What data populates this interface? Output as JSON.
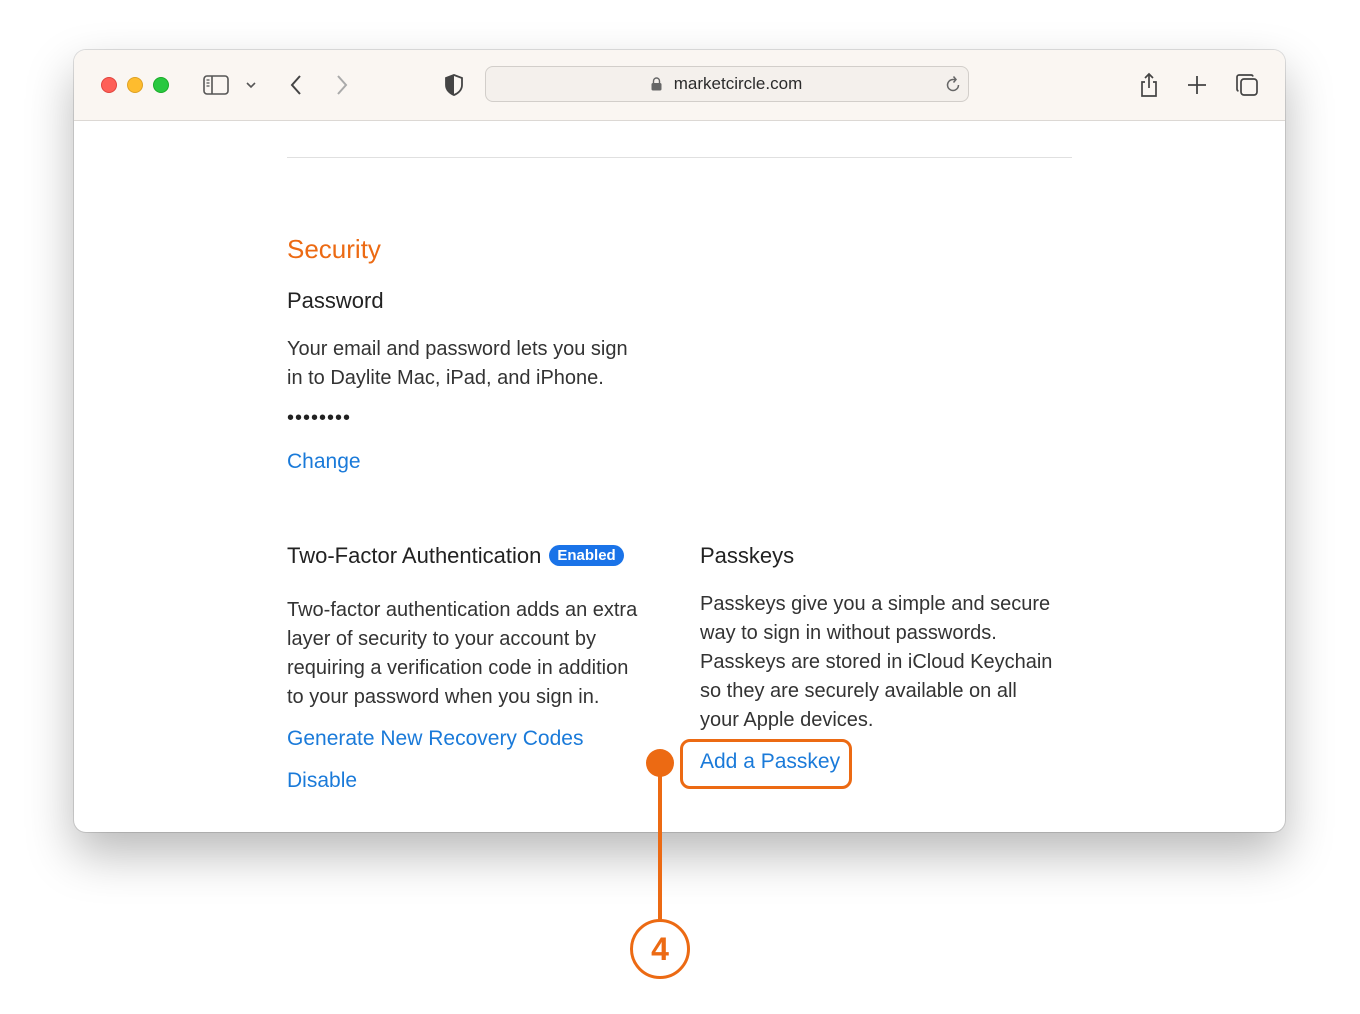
{
  "browser": {
    "url": "marketcircle.com"
  },
  "security": {
    "title": "Security",
    "password": {
      "heading": "Password",
      "description_lines": [
        "Your email and password lets you sign",
        "in to Daylite Mac, iPad, and iPhone."
      ],
      "masked_value": "••••••••",
      "change_link": "Change"
    },
    "two_factor": {
      "heading": "Two-Factor Authentication",
      "badge": "Enabled",
      "description_lines": [
        "Two-factor authentication adds an extra",
        "layer of security to your account by",
        "requiring a verification code in addition",
        "to your password when you sign in."
      ],
      "recovery_link": "Generate New Recovery Codes",
      "disable_link": "Disable"
    },
    "passkeys": {
      "heading": "Passkeys",
      "description_lines": [
        "Passkeys give you a simple and secure",
        "way to sign in without passwords.",
        "Passkeys are stored in iCloud Keychain",
        "so they are securely available on all",
        "your Apple devices."
      ],
      "add_link": "Add a Passkey"
    }
  },
  "callout": {
    "number": "4"
  },
  "colors": {
    "accent_orange": "#ec6a13",
    "link_blue": "#1a7ad9",
    "badge_blue": "#1a73e8"
  }
}
